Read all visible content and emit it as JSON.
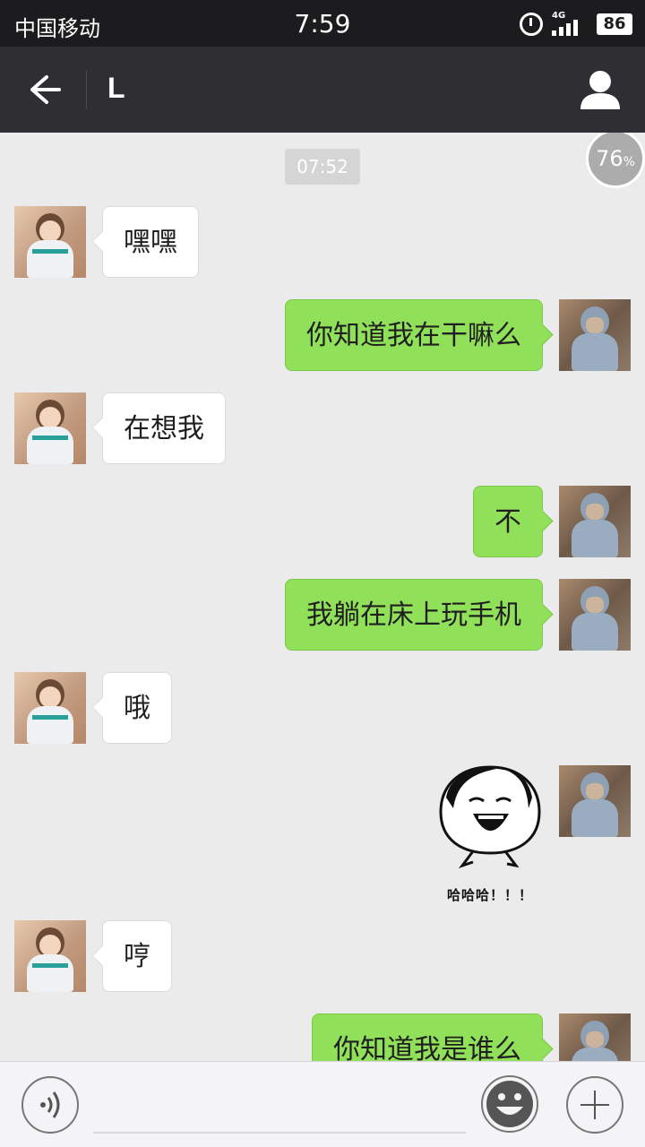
{
  "status_bar": {
    "carrier": "中国移动",
    "time": "7:59",
    "network": "4G",
    "battery": "86",
    "icons": [
      "alarm-icon",
      "signal-icon",
      "battery-icon"
    ]
  },
  "nav": {
    "title": "L",
    "back_icon": "back-arrow-icon",
    "profile_icon": "person-icon"
  },
  "chat": {
    "timestamp": "07:52",
    "progress_value": "76",
    "progress_unit": "%",
    "messages": [
      {
        "side": "left",
        "type": "text",
        "text": "嘿嘿"
      },
      {
        "side": "right",
        "type": "text",
        "text": "你知道我在干嘛么"
      },
      {
        "side": "left",
        "type": "text",
        "text": "在想我"
      },
      {
        "side": "right",
        "type": "text",
        "text": "不"
      },
      {
        "side": "right",
        "type": "text",
        "text": "我躺在床上玩手机"
      },
      {
        "side": "left",
        "type": "text",
        "text": "哦"
      },
      {
        "side": "right",
        "type": "sticker",
        "caption": "哈哈哈！！！"
      },
      {
        "side": "left",
        "type": "text",
        "text": "哼"
      },
      {
        "side": "right",
        "type": "text",
        "text": "你知道我是谁么"
      }
    ]
  },
  "input_bar": {
    "icons": [
      "voice-icon",
      "emoji-icon",
      "plus-icon"
    ]
  },
  "colors": {
    "status_bar": "#1c1c1e",
    "nav_bar": "#2f2f33",
    "chat_bg": "#ebebeb",
    "bubble_right": "#91e05a",
    "bubble_left": "#ffffff"
  }
}
